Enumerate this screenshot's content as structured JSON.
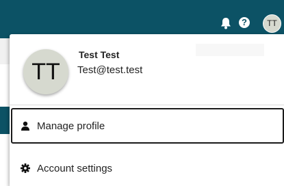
{
  "topbar": {
    "bell_icon": "bell-icon",
    "help_icon": "help-icon",
    "help_glyph": "?",
    "avatar_initials": "TT"
  },
  "profile": {
    "avatar_initials": "TT",
    "name": "Test Test",
    "email": "Test@test.test"
  },
  "menu": {
    "items": [
      {
        "label": "Manage profile",
        "icon": "user-icon"
      },
      {
        "label": "Account settings",
        "icon": "gear-icon"
      }
    ]
  },
  "colors": {
    "topbar": "#0c5265",
    "avatar_bg": "#d6d9cf"
  }
}
